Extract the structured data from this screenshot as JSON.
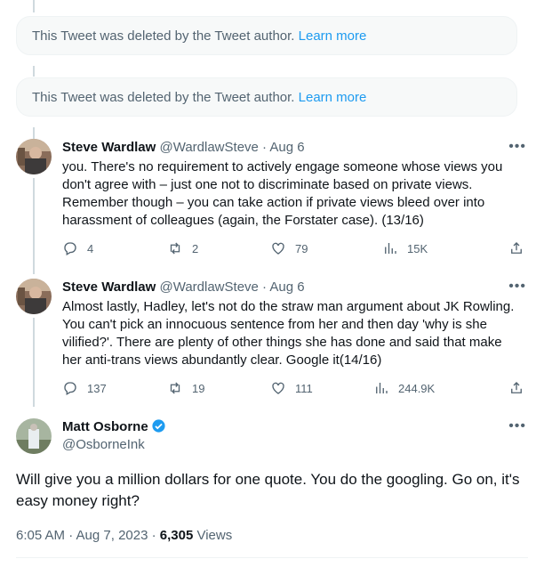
{
  "deleted_notice": {
    "text": "This Tweet was deleted by the Tweet author. ",
    "link": "Learn more"
  },
  "tweets": [
    {
      "name": "Steve Wardlaw",
      "handle": "@WardlawSteve",
      "sep": "·",
      "date": "Aug 6",
      "text": "you. There's no requirement to actively engage someone whose views you don't agree with – just one not to discriminate based on private views. Remember though – you can take action if private views bleed over into harassment of colleagues (again, the Forstater case). (13/16)",
      "replies": "4",
      "retweets": "2",
      "likes": "79",
      "views": "15K"
    },
    {
      "name": "Steve Wardlaw",
      "handle": "@WardlawSteve",
      "sep": "·",
      "date": "Aug 6",
      "text": "Almost lastly, Hadley, let's not do the straw man argument about JK Rowling. You can't pick an innocuous sentence from her and then day 'why is she vilified?'. There are plenty of other things she has done and said that make her anti-trans views abundantly clear. Google it(14/16)",
      "replies": "137",
      "retweets": "19",
      "likes": "111",
      "views": "244.9K"
    }
  ],
  "main_tweet": {
    "name": "Matt Osborne",
    "handle": "@OsborneInk",
    "text": "Will give you a million dollars for one quote. You do the googling. Go on, it's easy money right?",
    "time": "6:05 AM · Aug 7, 2023 · ",
    "views_count": "6,305",
    "views_label": " Views"
  },
  "colors": {
    "accent": "#1d9bf0",
    "muted": "#536471",
    "line": "#cfd9de"
  }
}
